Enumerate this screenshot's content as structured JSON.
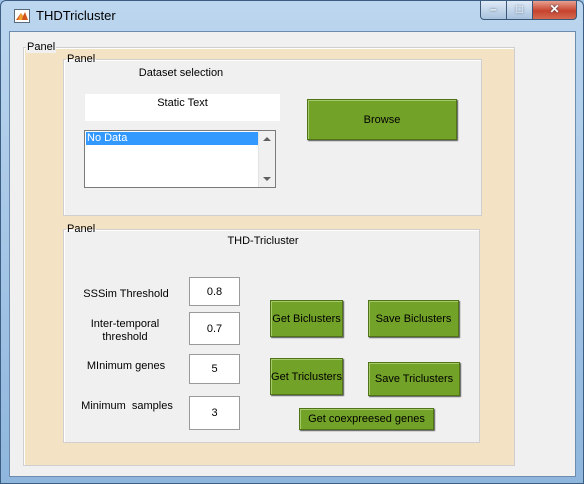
{
  "window": {
    "title": "THDTricluster",
    "controls": {
      "minimize": "–",
      "maximize": "□",
      "close": "✕"
    }
  },
  "outer_panel": {
    "title": "Panel"
  },
  "dataset_panel": {
    "title": "Panel",
    "heading": "Dataset selection",
    "static_text": "Static Text",
    "list": {
      "items": [
        "No Data"
      ],
      "selected": "No Data"
    },
    "browse_label": "Browse"
  },
  "tricluster_panel": {
    "title": "Panel",
    "heading": "THD-Tricluster",
    "params": [
      {
        "label": "SSSim Threshold",
        "value": "0.8"
      },
      {
        "label": "Inter-temporal threshold",
        "value": "0.7"
      },
      {
        "label": "MInimum genes",
        "value": "5"
      },
      {
        "label": "Minimum  samples",
        "value": "3"
      }
    ],
    "buttons": {
      "get_biclusters": "Get Biclusters",
      "save_biclusters": "Save Biclusters",
      "get_triclusters": "Get Triclusters",
      "save_triclusters": "Save Triclusters",
      "get_coexpressed": "Get coexpreesed genes"
    }
  },
  "colors": {
    "button_green": "#73a229",
    "panel_beige": "#f4e2c4",
    "selection_blue": "#3399ff"
  },
  "icons": [
    "matlab-icon",
    "minimize-icon",
    "maximize-icon",
    "close-icon",
    "scroll-up-icon",
    "scroll-down-icon"
  ]
}
